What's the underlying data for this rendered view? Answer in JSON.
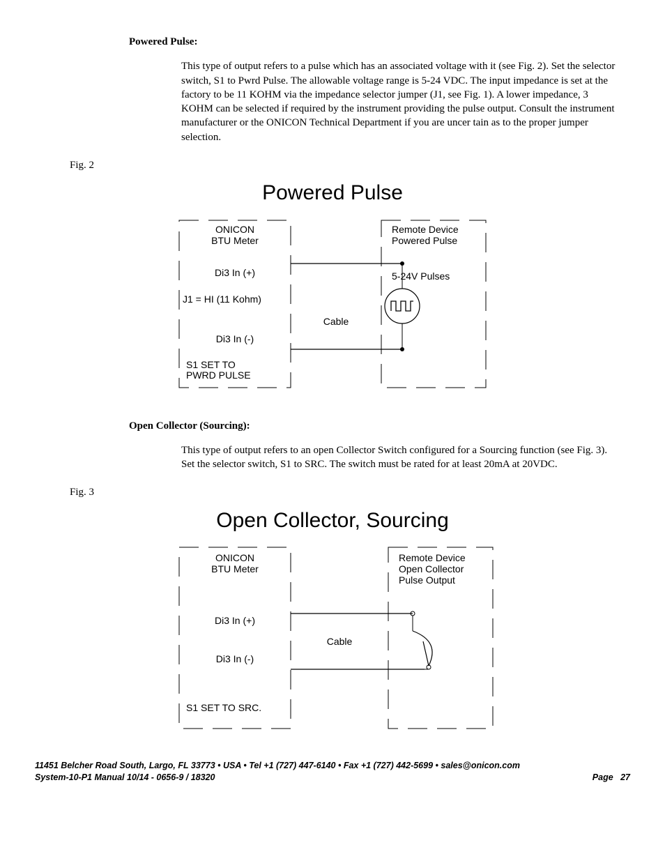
{
  "section1": {
    "heading": "Powered Pulse:",
    "text": "This type of output refers to a pulse which has an associated voltage with it (see Fig. 2). Set the selector switch, S1 to Pwrd Pulse. The allowable voltage range is 5-24 VDC. The input impedance is set at the factory to be 11 KOHM via the impedance selector jumper (J1, see Fig. 1). A lower impedance, 3 KOHM can be selected if required by the instrument providing the pulse output. Consult the instrument manufacturer or the ONICON Technical Department if you are uncer tain as to the proper jumper selection.",
    "figLabel": "Fig. 2"
  },
  "section2": {
    "heading": "Open Collector (Sourcing):",
    "text": "This type of output refers to an open Collector Switch configured for a Sourcing function (see Fig. 3). Set the selector switch, S1 to SRC. The switch must be rated for at least 20mA at 20VDC.",
    "figLabel": "Fig. 3"
  },
  "diagram1": {
    "title": "Powered Pulse",
    "leftBoxL1": "ONICON",
    "leftBoxL2": "BTU Meter",
    "di3pos": "Di3 In (+)",
    "j1note": "J1 = HI (11 Kohm)",
    "di3neg": "Di3 In (-)",
    "s1L1": "S1 SET TO",
    "s1L2": "PWRD PULSE",
    "cable": "Cable",
    "rightBoxL1": "Remote Device",
    "rightBoxL2": "Powered Pulse",
    "volts": "5-24V Pulses"
  },
  "diagram2": {
    "title": "Open Collector, Sourcing",
    "leftBoxL1": "ONICON",
    "leftBoxL2": "BTU Meter",
    "di3pos": "Di3 In (+)",
    "di3neg": "Di3 In (-)",
    "s1note": "S1 SET TO SRC.",
    "cable": "Cable",
    "rightBoxL1": "Remote Device",
    "rightBoxL2": "Open Collector",
    "rightBoxL3": "Pulse Output"
  },
  "footer": {
    "line1": "11451 Belcher Road South, Largo, FL 33773 • USA • Tel +1 (727) 447-6140 • Fax +1 (727) 442-5699 • sales@onicon.com",
    "line2left": "System-10-P1 Manual 10/14 - 0656-9 / 18320",
    "line2rightPrefix": "Page",
    "pageNum": "27"
  }
}
